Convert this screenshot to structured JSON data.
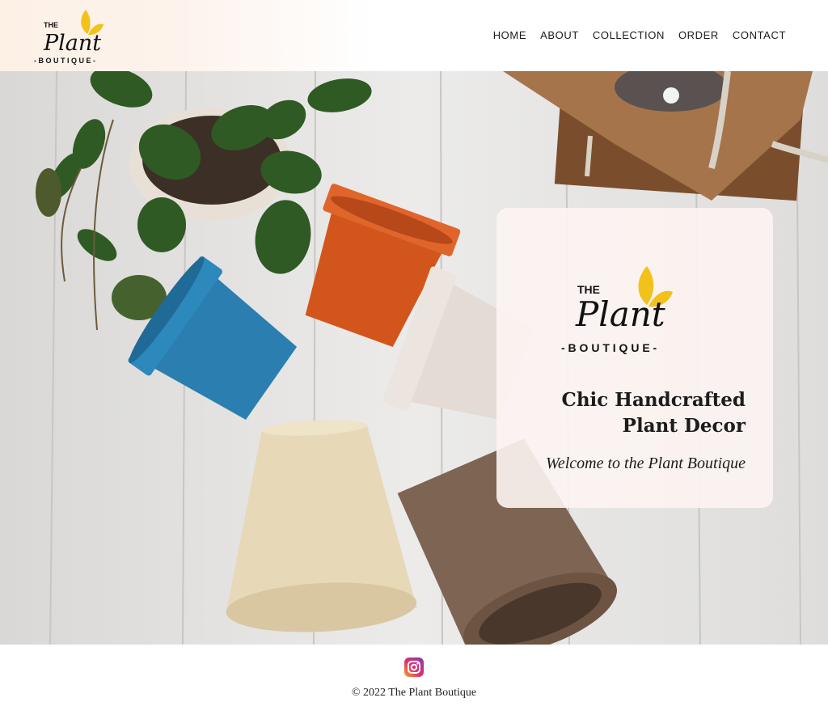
{
  "brand": {
    "the": "THE",
    "plant": "Plant",
    "boutique": "- B O U T I Q U E -",
    "accent_color": "#f2c21b"
  },
  "nav": {
    "items": [
      {
        "label": "HOME"
      },
      {
        "label": "ABOUT"
      },
      {
        "label": "COLLECTION"
      },
      {
        "label": "ORDER"
      },
      {
        "label": "CONTACT"
      }
    ]
  },
  "hero": {
    "headline_line1": "Chic Handcrafted",
    "headline_line2": "Plant Decor",
    "subline": "Welcome to the Plant Boutique"
  },
  "footer": {
    "social_icon": "instagram-icon",
    "copyright": "© 2022 The Plant Boutique"
  },
  "colors": {
    "pot_orange": "#d8581e",
    "pot_blue": "#2a7fb0",
    "pot_white": "#e6ded8",
    "pot_cream": "#e9dcc0",
    "pot_brown": "#7d6453",
    "leaf_green": "#2f5a24",
    "wood": "#9a6a3e"
  }
}
